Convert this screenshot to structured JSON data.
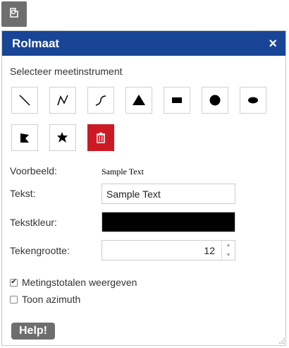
{
  "toolbar": {
    "icon": "measure-tool-icon"
  },
  "panel": {
    "title": "Rolmaat",
    "close_label": "×"
  },
  "measure": {
    "select_label": "Selecteer meetinstrument",
    "tools": [
      {
        "name": "line",
        "icon": "line-icon"
      },
      {
        "name": "polyline",
        "icon": "polyline-icon"
      },
      {
        "name": "freehand-line",
        "icon": "freehand-line-icon"
      },
      {
        "name": "triangle",
        "icon": "triangle-icon"
      },
      {
        "name": "rectangle",
        "icon": "rectangle-icon"
      },
      {
        "name": "circle",
        "icon": "circle-icon"
      },
      {
        "name": "ellipse",
        "icon": "ellipse-icon"
      },
      {
        "name": "polygon",
        "icon": "polygon-icon"
      },
      {
        "name": "freehand-polygon",
        "icon": "freehand-polygon-icon"
      },
      {
        "name": "delete",
        "icon": "trash-icon"
      }
    ],
    "delete_color": "#cc1a24"
  },
  "form": {
    "preview_label": "Voorbeeld:",
    "preview_text": "Sample Text",
    "text_label": "Tekst:",
    "text_value": "Sample Text",
    "color_label": "Tekstkleur:",
    "color_value": "#000000",
    "size_label": "Tekengrootte:",
    "size_value": "12"
  },
  "options": {
    "show_totals_label": "Metingstotalen weergeven",
    "show_totals_checked": true,
    "show_azimuth_label": "Toon azimuth",
    "show_azimuth_checked": false
  },
  "help_label": "Help!",
  "colors": {
    "header": "#184596",
    "delete": "#cc1a24",
    "help": "#6e6e6e"
  }
}
